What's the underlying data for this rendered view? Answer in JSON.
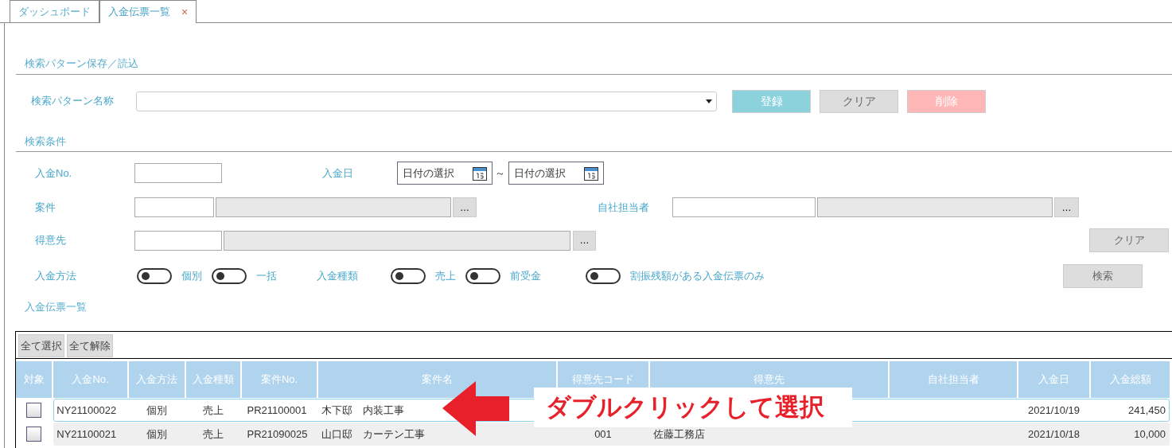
{
  "tabs": [
    {
      "label": "ダッシュボード",
      "selected": false
    },
    {
      "label": "入金伝票一覧",
      "selected": true,
      "close": "×"
    }
  ],
  "pattern": {
    "title": "検索パターン保存／読込",
    "label": "検索パターン名称",
    "buttons": [
      {
        "label": "登録",
        "kind": "primary"
      },
      {
        "label": "クリア",
        "kind": "secondary"
      },
      {
        "label": "削除",
        "kind": "danger"
      }
    ]
  },
  "criteria": {
    "title": "検索条件",
    "payment_no": {
      "label": "入金No."
    },
    "date": {
      "label": "入金日",
      "from_placeholder": "日付の選択",
      "separator": "～",
      "to_placeholder": "日付の選択"
    },
    "project": {
      "label": "案件",
      "more": "…"
    },
    "staff": {
      "label": "自社担当者",
      "more": "…"
    },
    "customer": {
      "label": "得意先",
      "more": "…"
    },
    "method": {
      "label": "入金方法",
      "options": [
        {
          "label": "個別",
          "on": false
        },
        {
          "label": "一括",
          "on": false
        }
      ]
    },
    "type": {
      "label": "入金種類",
      "options": [
        {
          "label": "売上",
          "on": false
        },
        {
          "label": "前受金",
          "on": false
        }
      ]
    },
    "remaining": {
      "label": "割振残額がある入金伝票のみ",
      "on": false
    },
    "clear_button": "クリア",
    "search_button": "検索"
  },
  "list": {
    "title": "入金伝票一覧",
    "toolbar": [
      "全て選択",
      "全て解除"
    ],
    "check_column": "対象",
    "columns": [
      "入金No.",
      "入金方法",
      "入金種類",
      "案件No.",
      "案件名",
      "得意先コード",
      "得意先",
      "自社担当者",
      "入金日",
      "入金総額"
    ],
    "rows": [
      {
        "checked": false,
        "selected": true,
        "cells": [
          "NY21100022",
          "個別",
          "売上",
          "PR21100001",
          "木下邸　内装工事",
          null,
          null,
          null,
          "2021/10/19",
          "241,450"
        ]
      },
      {
        "checked": false,
        "selected": false,
        "cells": [
          "NY21100021",
          "個別",
          "売上",
          "PR21090025",
          "山口邸　カーテン工事",
          "001",
          "佐藤工務店",
          null,
          "2021/10/18",
          "10,000"
        ]
      }
    ]
  },
  "callout": {
    "text": "ダブルクリックして選択"
  }
}
